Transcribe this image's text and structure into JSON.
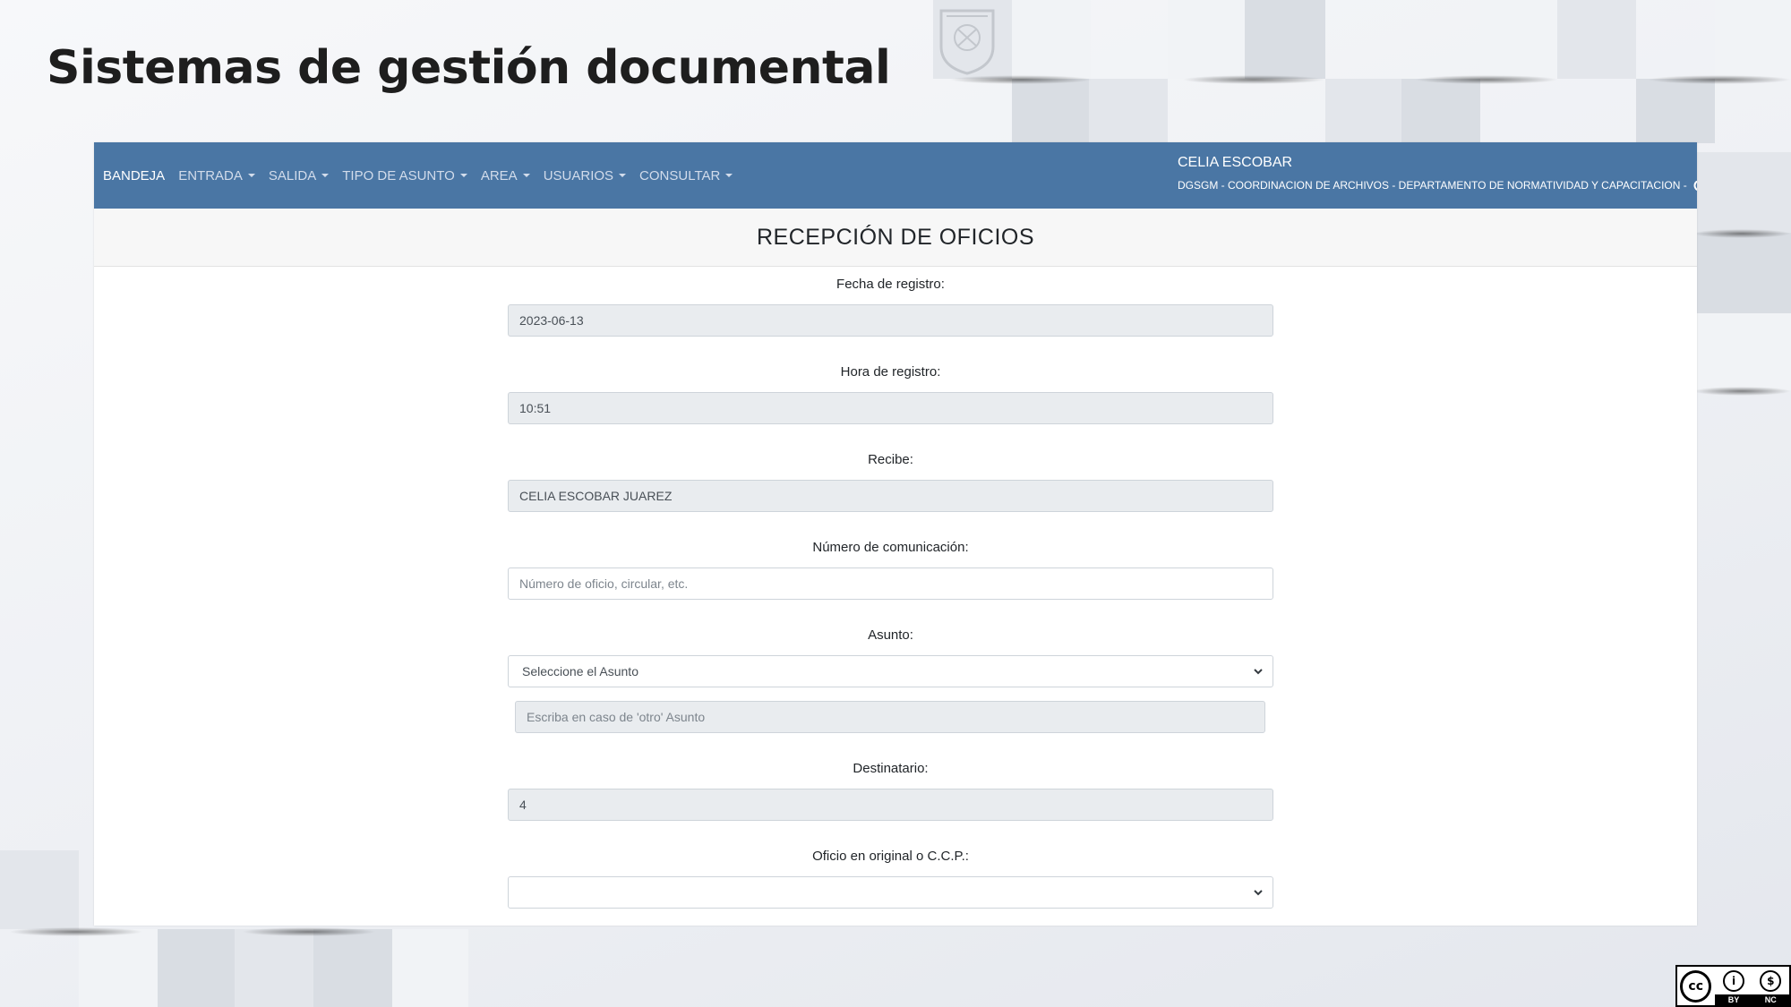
{
  "slide": {
    "title": "Sistemas de gestión documental"
  },
  "navbar": {
    "items": [
      {
        "label": "BANDEJA",
        "dropdown": false,
        "active": true
      },
      {
        "label": "ENTRADA",
        "dropdown": true
      },
      {
        "label": "SALIDA",
        "dropdown": true
      },
      {
        "label": "TIPO DE ASUNTO",
        "dropdown": true
      },
      {
        "label": "AREA",
        "dropdown": true
      },
      {
        "label": "USUARIOS",
        "dropdown": true
      },
      {
        "label": "CONSULTAR",
        "dropdown": true
      }
    ],
    "user_name": "CELIA ESCOBAR",
    "user_dept": "DGSGM - COORDINACION DE ARCHIVOS - DEPARTAMENTO DE NORMATIVIDAD Y CAPACITACION -"
  },
  "card": {
    "title": "RECEPCIÓN DE OFICIOS"
  },
  "form": {
    "fecha": {
      "label": "Fecha de registro:",
      "value": "2023-06-13"
    },
    "hora": {
      "label": "Hora de registro:",
      "value": "10:51"
    },
    "recibe": {
      "label": "Recibe:",
      "value": "CELIA ESCOBAR JUAREZ"
    },
    "numero": {
      "label": "Número de comunicación:",
      "placeholder": "Número de oficio, circular, etc."
    },
    "asunto": {
      "label": "Asunto:",
      "selected": "Seleccione el Asunto",
      "other_placeholder": "Escriba en caso de 'otro' Asunto"
    },
    "destinatario": {
      "label": "Destinatario:",
      "value": "4"
    },
    "oficio": {
      "label": "Oficio en original o C.C.P.:",
      "selected": ""
    }
  },
  "license": {
    "by": "BY",
    "nc": "NC"
  },
  "colors": {
    "navbar": "#4a76a4",
    "readonly_field": "#e9ecef",
    "card_header": "#f7f7f7"
  }
}
